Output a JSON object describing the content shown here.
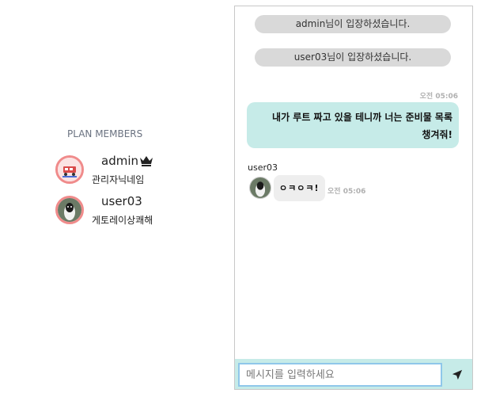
{
  "members": {
    "title": "PLAN MEMBERS",
    "list": [
      {
        "name": "admin",
        "nickname": "관리자닉네임",
        "badge": "crown-icon"
      },
      {
        "name": "user03",
        "nickname": "게토레이상쾌해"
      }
    ]
  },
  "chat": {
    "notices": [
      "admin님이 입장하셨습니다.",
      "user03님이 입장하셨습니다."
    ],
    "messages": [
      {
        "sender": "",
        "time": "오전 05:06",
        "text": "내가 루트 짜고 있을 테니까 너는 준비물 목록 챙겨줘!",
        "mine": true
      },
      {
        "sender": "user03",
        "time": "오전 05:06",
        "text": "ㅇㅋㅇㅋ!",
        "mine": false
      }
    ],
    "input": {
      "placeholder": "메시지를 입력하세요",
      "value": ""
    },
    "send_icon": "send-icon"
  },
  "colors": {
    "my_bubble": "#c6ebe8",
    "notice": "#d9d9d9",
    "avatar_border": "#f08b8b",
    "input_border": "#8fc7ea"
  }
}
